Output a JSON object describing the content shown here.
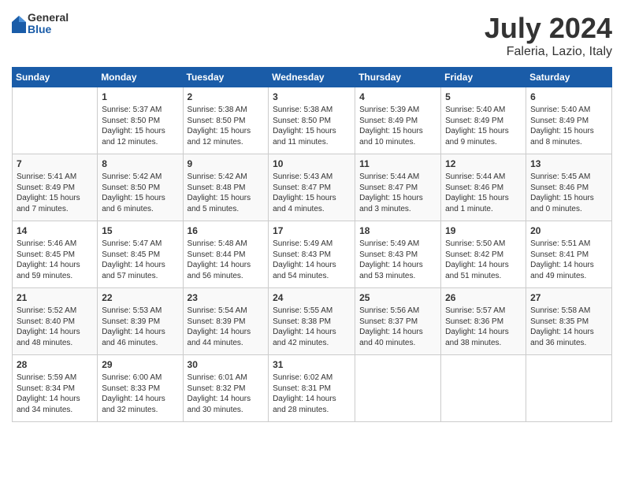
{
  "header": {
    "logo": {
      "general": "General",
      "blue": "Blue"
    },
    "title": "July 2024",
    "subtitle": "Faleria, Lazio, Italy"
  },
  "weekdays": [
    "Sunday",
    "Monday",
    "Tuesday",
    "Wednesday",
    "Thursday",
    "Friday",
    "Saturday"
  ],
  "weeks": [
    [
      {
        "day": "",
        "sunrise": "",
        "sunset": "",
        "daylight": ""
      },
      {
        "day": "1",
        "sunrise": "Sunrise: 5:37 AM",
        "sunset": "Sunset: 8:50 PM",
        "daylight": "Daylight: 15 hours and 12 minutes."
      },
      {
        "day": "2",
        "sunrise": "Sunrise: 5:38 AM",
        "sunset": "Sunset: 8:50 PM",
        "daylight": "Daylight: 15 hours and 12 minutes."
      },
      {
        "day": "3",
        "sunrise": "Sunrise: 5:38 AM",
        "sunset": "Sunset: 8:50 PM",
        "daylight": "Daylight: 15 hours and 11 minutes."
      },
      {
        "day": "4",
        "sunrise": "Sunrise: 5:39 AM",
        "sunset": "Sunset: 8:49 PM",
        "daylight": "Daylight: 15 hours and 10 minutes."
      },
      {
        "day": "5",
        "sunrise": "Sunrise: 5:40 AM",
        "sunset": "Sunset: 8:49 PM",
        "daylight": "Daylight: 15 hours and 9 minutes."
      },
      {
        "day": "6",
        "sunrise": "Sunrise: 5:40 AM",
        "sunset": "Sunset: 8:49 PM",
        "daylight": "Daylight: 15 hours and 8 minutes."
      }
    ],
    [
      {
        "day": "7",
        "sunrise": "Sunrise: 5:41 AM",
        "sunset": "Sunset: 8:49 PM",
        "daylight": "Daylight: 15 hours and 7 minutes."
      },
      {
        "day": "8",
        "sunrise": "Sunrise: 5:42 AM",
        "sunset": "Sunset: 8:50 PM",
        "daylight": "Daylight: 15 hours and 6 minutes."
      },
      {
        "day": "9",
        "sunrise": "Sunrise: 5:42 AM",
        "sunset": "Sunset: 8:48 PM",
        "daylight": "Daylight: 15 hours and 5 minutes."
      },
      {
        "day": "10",
        "sunrise": "Sunrise: 5:43 AM",
        "sunset": "Sunset: 8:47 PM",
        "daylight": "Daylight: 15 hours and 4 minutes."
      },
      {
        "day": "11",
        "sunrise": "Sunrise: 5:44 AM",
        "sunset": "Sunset: 8:47 PM",
        "daylight": "Daylight: 15 hours and 3 minutes."
      },
      {
        "day": "12",
        "sunrise": "Sunrise: 5:44 AM",
        "sunset": "Sunset: 8:46 PM",
        "daylight": "Daylight: 15 hours and 1 minute."
      },
      {
        "day": "13",
        "sunrise": "Sunrise: 5:45 AM",
        "sunset": "Sunset: 8:46 PM",
        "daylight": "Daylight: 15 hours and 0 minutes."
      }
    ],
    [
      {
        "day": "14",
        "sunrise": "Sunrise: 5:46 AM",
        "sunset": "Sunset: 8:45 PM",
        "daylight": "Daylight: 14 hours and 59 minutes."
      },
      {
        "day": "15",
        "sunrise": "Sunrise: 5:47 AM",
        "sunset": "Sunset: 8:45 PM",
        "daylight": "Daylight: 14 hours and 57 minutes."
      },
      {
        "day": "16",
        "sunrise": "Sunrise: 5:48 AM",
        "sunset": "Sunset: 8:44 PM",
        "daylight": "Daylight: 14 hours and 56 minutes."
      },
      {
        "day": "17",
        "sunrise": "Sunrise: 5:49 AM",
        "sunset": "Sunset: 8:43 PM",
        "daylight": "Daylight: 14 hours and 54 minutes."
      },
      {
        "day": "18",
        "sunrise": "Sunrise: 5:49 AM",
        "sunset": "Sunset: 8:43 PM",
        "daylight": "Daylight: 14 hours and 53 minutes."
      },
      {
        "day": "19",
        "sunrise": "Sunrise: 5:50 AM",
        "sunset": "Sunset: 8:42 PM",
        "daylight": "Daylight: 14 hours and 51 minutes."
      },
      {
        "day": "20",
        "sunrise": "Sunrise: 5:51 AM",
        "sunset": "Sunset: 8:41 PM",
        "daylight": "Daylight: 14 hours and 49 minutes."
      }
    ],
    [
      {
        "day": "21",
        "sunrise": "Sunrise: 5:52 AM",
        "sunset": "Sunset: 8:40 PM",
        "daylight": "Daylight: 14 hours and 48 minutes."
      },
      {
        "day": "22",
        "sunrise": "Sunrise: 5:53 AM",
        "sunset": "Sunset: 8:39 PM",
        "daylight": "Daylight: 14 hours and 46 minutes."
      },
      {
        "day": "23",
        "sunrise": "Sunrise: 5:54 AM",
        "sunset": "Sunset: 8:39 PM",
        "daylight": "Daylight: 14 hours and 44 minutes."
      },
      {
        "day": "24",
        "sunrise": "Sunrise: 5:55 AM",
        "sunset": "Sunset: 8:38 PM",
        "daylight": "Daylight: 14 hours and 42 minutes."
      },
      {
        "day": "25",
        "sunrise": "Sunrise: 5:56 AM",
        "sunset": "Sunset: 8:37 PM",
        "daylight": "Daylight: 14 hours and 40 minutes."
      },
      {
        "day": "26",
        "sunrise": "Sunrise: 5:57 AM",
        "sunset": "Sunset: 8:36 PM",
        "daylight": "Daylight: 14 hours and 38 minutes."
      },
      {
        "day": "27",
        "sunrise": "Sunrise: 5:58 AM",
        "sunset": "Sunset: 8:35 PM",
        "daylight": "Daylight: 14 hours and 36 minutes."
      }
    ],
    [
      {
        "day": "28",
        "sunrise": "Sunrise: 5:59 AM",
        "sunset": "Sunset: 8:34 PM",
        "daylight": "Daylight: 14 hours and 34 minutes."
      },
      {
        "day": "29",
        "sunrise": "Sunrise: 6:00 AM",
        "sunset": "Sunset: 8:33 PM",
        "daylight": "Daylight: 14 hours and 32 minutes."
      },
      {
        "day": "30",
        "sunrise": "Sunrise: 6:01 AM",
        "sunset": "Sunset: 8:32 PM",
        "daylight": "Daylight: 14 hours and 30 minutes."
      },
      {
        "day": "31",
        "sunrise": "Sunrise: 6:02 AM",
        "sunset": "Sunset: 8:31 PM",
        "daylight": "Daylight: 14 hours and 28 minutes."
      },
      {
        "day": "",
        "sunrise": "",
        "sunset": "",
        "daylight": ""
      },
      {
        "day": "",
        "sunrise": "",
        "sunset": "",
        "daylight": ""
      },
      {
        "day": "",
        "sunrise": "",
        "sunset": "",
        "daylight": ""
      }
    ]
  ]
}
